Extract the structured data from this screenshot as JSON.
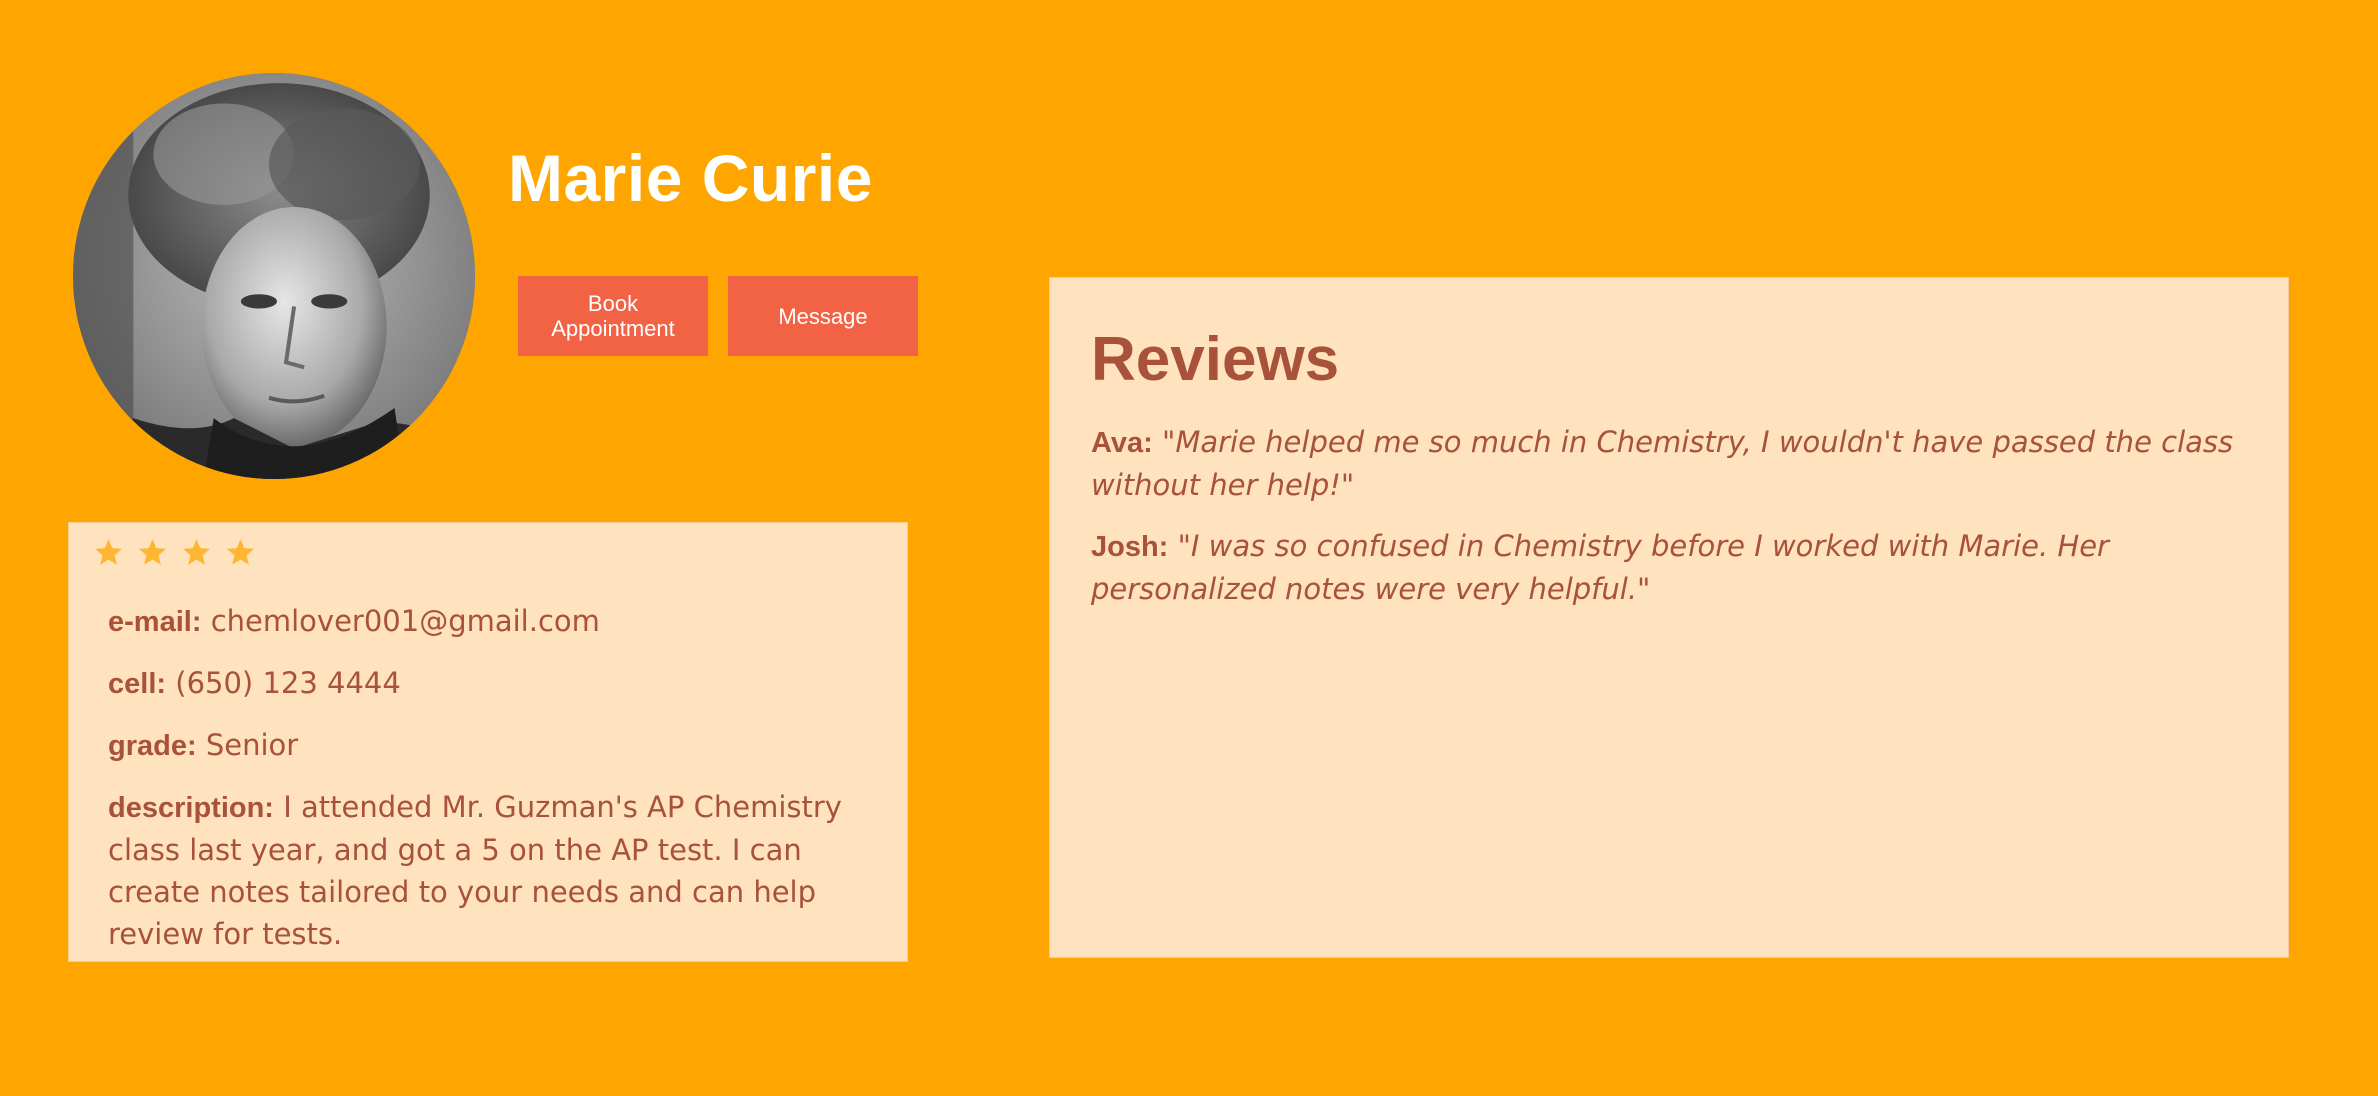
{
  "profile": {
    "name": "Marie Curie",
    "rating_stars": 4
  },
  "actions": {
    "book_label": "Book Appointment",
    "message_label": "Message"
  },
  "info": {
    "email_label": "e-mail:",
    "email_value": "chemlover001@gmail.com",
    "cell_label": "cell:",
    "cell_value": "(650) 123 4444",
    "grade_label": "grade:",
    "grade_value": "Senior",
    "description_label": "description:",
    "description_value": "I attended Mr. Guzman's AP Chemistry class last year, and got a 5 on the AP test. I can create notes tailored to your needs and can help review for tests."
  },
  "reviews": {
    "title": "Reviews",
    "items": [
      {
        "author": "Ava:",
        "text": "\"Marie helped me so much in Chemistry, I wouldn't have passed the class without her help!\""
      },
      {
        "author": "Josh:",
        "text": "\"I was so confused in Chemistry before I worked with Marie. Her personalized notes were very helpful.\""
      }
    ]
  },
  "colors": {
    "background": "#FFA500",
    "panel": "#FFE3BF",
    "accent_text": "#A8523A",
    "button": "#F26245",
    "star": "#FFB733"
  },
  "icons": {
    "avatar": "profile-photo",
    "rating": "star-icon"
  }
}
